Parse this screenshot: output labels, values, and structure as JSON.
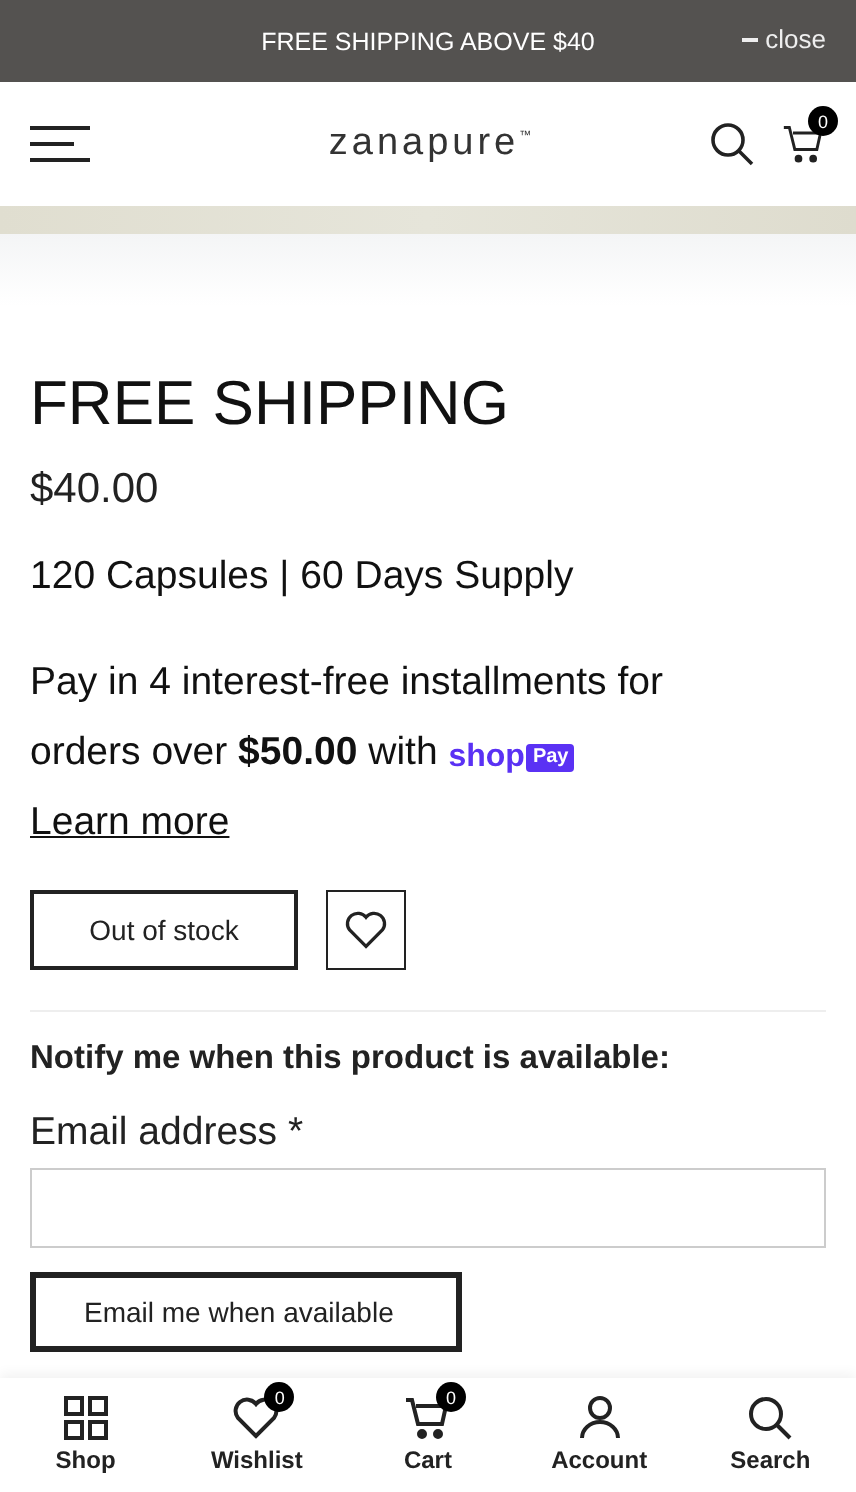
{
  "announcement": {
    "text": "FREE SHIPPING ABOVE $40",
    "close": "close"
  },
  "header": {
    "logo": "zanapure",
    "trademark": "™",
    "cart_count": "0"
  },
  "product": {
    "title": "FREE SHIPPING",
    "price": "$40.00",
    "variant": "120 Capsules | 60 Days Supply",
    "installments": [
      "Pay in 4 interest-free installments for",
      "orders over **$50.00** with"
    ],
    "shop_pay": {
      "shop": "shop",
      "pay": "Pay"
    },
    "learn_more": "Learn more",
    "stock_button": "Out of stock"
  },
  "notify": {
    "heading": "Notify me when this product is available:",
    "email_label": "Email address",
    "required": "*",
    "button": "Email me when available"
  },
  "bottom_nav": [
    {
      "kind": "shop",
      "label": "Shop"
    },
    {
      "kind": "wishlist",
      "label": "Wishlist",
      "badge": "0"
    },
    {
      "kind": "cart",
      "label": "Cart",
      "badge": "0"
    },
    {
      "kind": "account",
      "label": "Account"
    },
    {
      "kind": "search",
      "label": "Search"
    }
  ]
}
